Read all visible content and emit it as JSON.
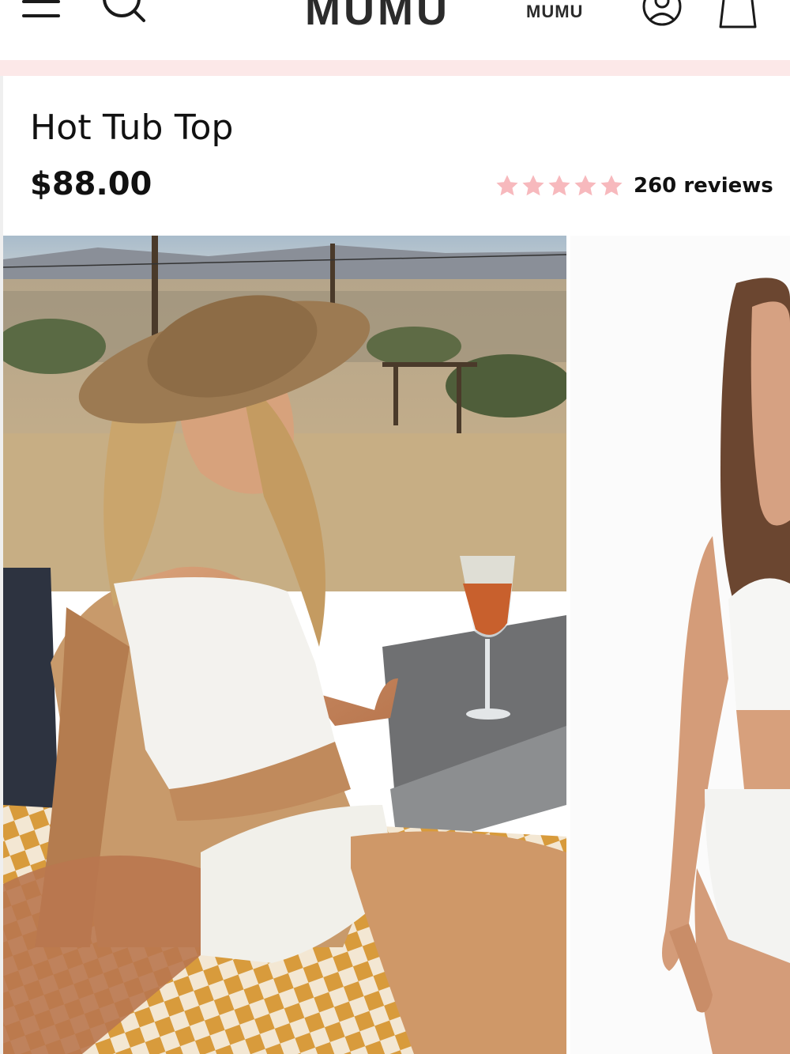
{
  "header": {
    "brand": "MUMU",
    "brand_secondary": "MUMU",
    "icons": [
      "menu-icon",
      "search-icon",
      "account-icon",
      "bag-icon"
    ]
  },
  "product": {
    "title": "Hot Tub Top",
    "price": "$88.00",
    "rating": 5,
    "rating_max": 5,
    "reviews_label": "260 reviews"
  },
  "colors": {
    "star": "#f7b9bd",
    "promo_bar": "#fce8e8",
    "text": "#111111"
  }
}
